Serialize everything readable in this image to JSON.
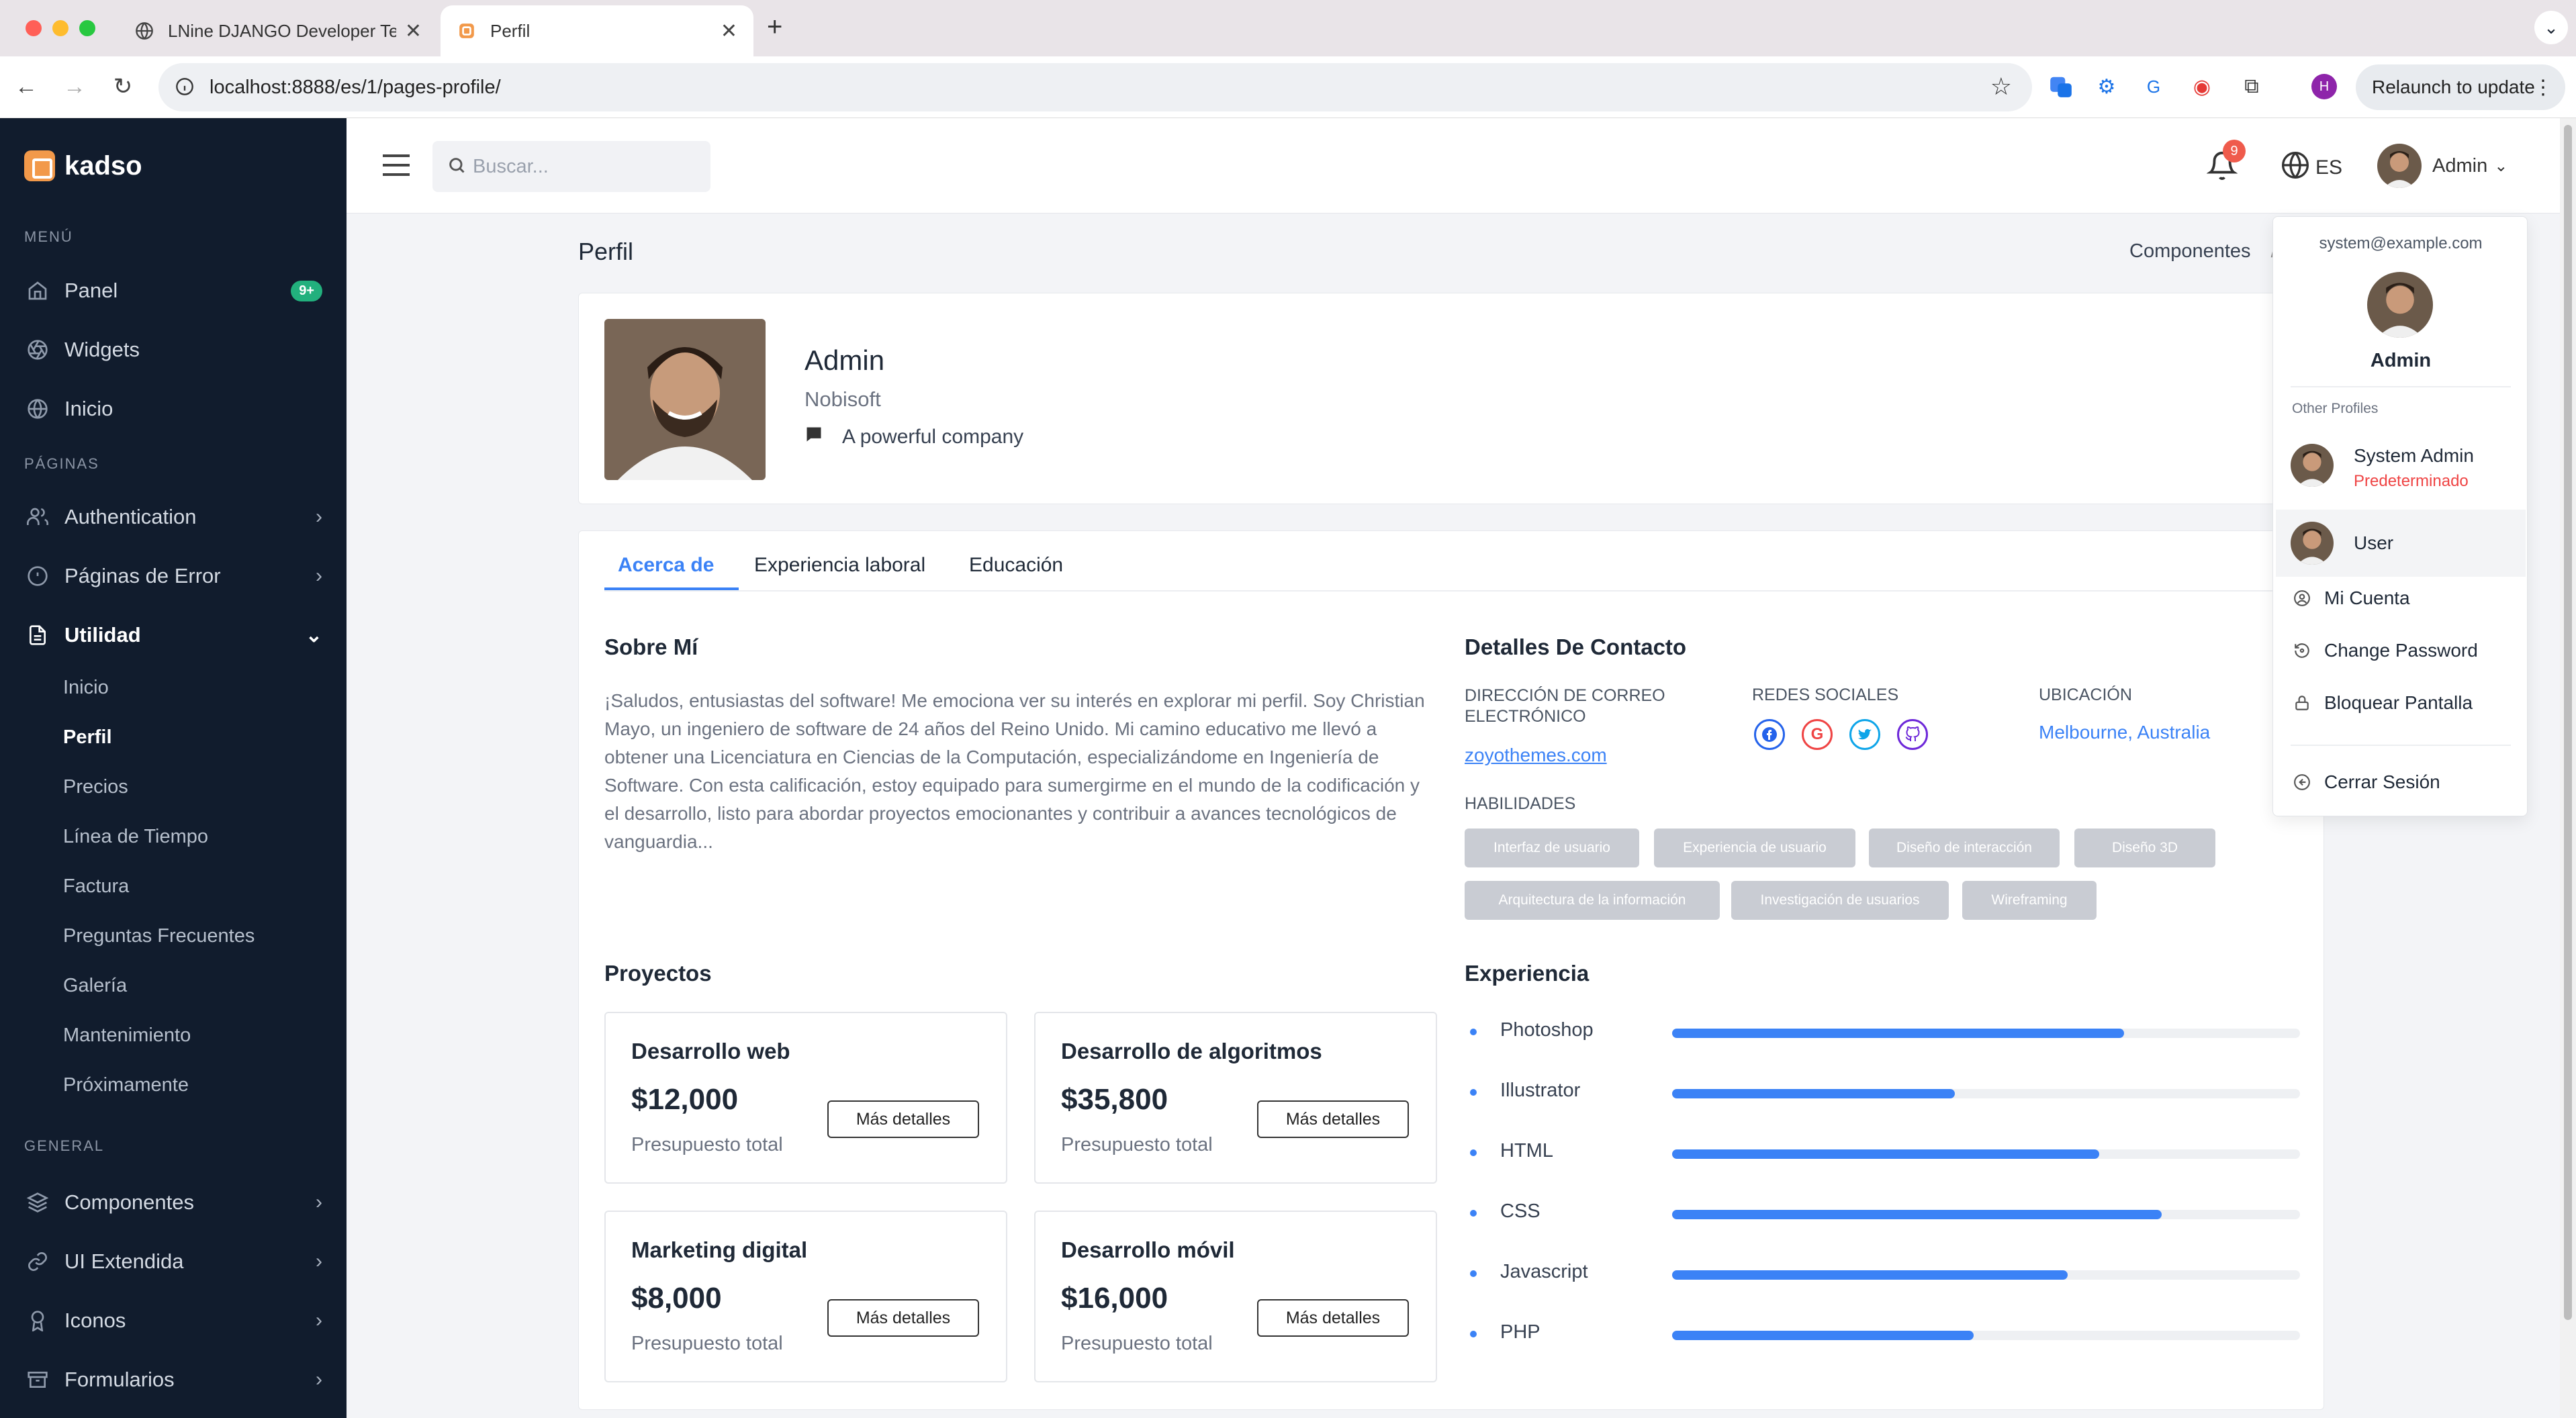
{
  "browser": {
    "tabs": [
      {
        "title": "LNine DJANGO Developer Te",
        "active": false
      },
      {
        "title": "Perfil",
        "active": true
      }
    ],
    "new_tab": "+",
    "url": "localhost:8888/es/1/pages-profile/",
    "profile_initial": "H",
    "relaunch_label": "Relaunch to update"
  },
  "sidebar": {
    "brand": "kadso",
    "sections": {
      "menu": "MENÚ",
      "pages": "PÁGINAS",
      "general": "GENERAL"
    },
    "menu_items": [
      {
        "label": "Panel",
        "icon": "home-icon",
        "badge": "9+"
      },
      {
        "label": "Widgets",
        "icon": "aperture-icon"
      },
      {
        "label": "Inicio",
        "icon": "globe-icon"
      }
    ],
    "page_items": [
      {
        "label": "Authentication",
        "icon": "users-icon"
      },
      {
        "label": "Páginas de Error",
        "icon": "alert-circle-icon"
      },
      {
        "label": "Utilidad",
        "icon": "file-icon",
        "expanded": true
      }
    ],
    "utilidad_sub": [
      "Inicio",
      "Perfil",
      "Precios",
      "Línea de Tiempo",
      "Factura",
      "Preguntas Frecuentes",
      "Galería",
      "Mantenimiento",
      "Próximamente"
    ],
    "active_sub": "Perfil",
    "general_items": [
      {
        "label": "Componentes",
        "icon": "layers-icon"
      },
      {
        "label": "UI Extendida",
        "icon": "link-icon"
      },
      {
        "label": "Iconos",
        "icon": "award-icon"
      },
      {
        "label": "Formularios",
        "icon": "archive-icon"
      }
    ]
  },
  "header": {
    "search_placeholder": "Buscar...",
    "notification_count": "9",
    "language": "ES",
    "user_name": "Admin"
  },
  "page": {
    "title": "Perfil",
    "breadcrumb": "Componentes",
    "breadcrumb_sep": "/"
  },
  "profile": {
    "name": "Admin",
    "company": "Nobisoft",
    "tagline": "A powerful company"
  },
  "tabs": [
    "Acerca de",
    "Experiencia laboral",
    "Educación"
  ],
  "active_tab": "Acerca de",
  "about": {
    "heading": "Sobre Mí",
    "text": "¡Saludos, entusiastas del software! Me emociona ver su interés en explorar mi perfil. Soy Christian Mayo, un ingeniero de software de 24 años del Reino Unido. Mi camino educativo me llevó a obtener una Licenciatura en Ciencias de la Computación, especializándome en Ingeniería de Software. Con esta calificación, estoy equipado para sumergirme en el mundo de la codificación y el desarrollo, listo para abordar proyectos emocionantes y contribuir a avances tecnológicos de vanguardia..."
  },
  "contact": {
    "heading": "Detalles De Contacto",
    "email_label": "DIRECCIÓN DE CORREO ELECTRÓNICO",
    "email_value": "zoyothemes.com",
    "social_label": "REDES SOCIALES",
    "social_icons": [
      {
        "icon": "facebook-icon",
        "color": "#2563eb"
      },
      {
        "icon": "google-icon",
        "color": "#ef4444"
      },
      {
        "icon": "twitter-icon",
        "color": "#0ea5e9"
      },
      {
        "icon": "github-icon",
        "color": "#6d28d9"
      }
    ],
    "location_label": "UBICACIÓN",
    "location_value": "Melbourne, Australia",
    "skills_label": "HABILIDADES",
    "skills": [
      "Interfaz de usuario",
      "Experiencia de usuario",
      "Diseño de interacción",
      "Diseño 3D",
      "Arquitectura de la información",
      "Investigación de usuarios",
      "Wireframing"
    ]
  },
  "projects": {
    "heading": "Proyectos",
    "items": [
      {
        "title": "Desarrollo web",
        "amount": "$12,000",
        "label": "Presupuesto total",
        "button": "Más detalles"
      },
      {
        "title": "Desarrollo de algoritmos",
        "amount": "$35,800",
        "label": "Presupuesto total",
        "button": "Más detalles"
      },
      {
        "title": "Marketing digital",
        "amount": "$8,000",
        "label": "Presupuesto total",
        "button": "Más detalles"
      },
      {
        "title": "Desarrollo móvil",
        "amount": "$16,000",
        "label": "Presupuesto total",
        "button": "Más detalles"
      }
    ]
  },
  "experience": {
    "heading": "Experiencia",
    "items": [
      {
        "label": "Photoshop",
        "level": 0.72
      },
      {
        "label": "Illustrator",
        "level": 0.45
      },
      {
        "label": "HTML",
        "level": 0.68
      },
      {
        "label": "CSS",
        "level": 0.78
      },
      {
        "label": "Javascript",
        "level": 0.63
      },
      {
        "label": "PHP",
        "level": 0.48
      }
    ]
  },
  "dropdown": {
    "email": "system@example.com",
    "name": "Admin",
    "other_profiles_label": "Other Profiles",
    "profiles": [
      {
        "name": "System Admin",
        "tag": "Predeterminado"
      },
      {
        "name": "User",
        "tag": ""
      }
    ],
    "items": [
      {
        "label": "Mi Cuenta",
        "icon": "user-circle-icon"
      },
      {
        "label": "Change Password",
        "icon": "refresh-icon"
      },
      {
        "label": "Bloquear Pantalla",
        "icon": "lock-icon"
      }
    ],
    "logout": "Cerrar Sesión"
  },
  "colors": {
    "sidebar_bg": "#111c2d",
    "accent": "#3b82f6",
    "badge_green": "#22b07d",
    "notification_red": "#ef5b4c",
    "predeterminado_red": "#ef4444"
  }
}
